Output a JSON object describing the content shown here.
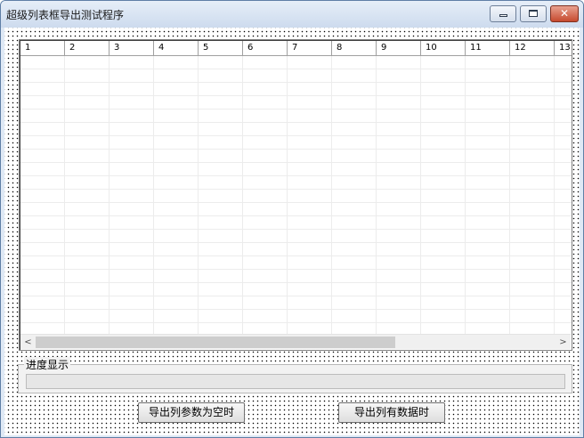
{
  "window": {
    "title": "超级列表框导出测试程序",
    "close_glyph": "✕",
    "colors": {
      "frame": "#dfe9f5",
      "close_button": "#c64a2f",
      "progress_fill": "#06b025"
    }
  },
  "grid": {
    "columns": [
      "1",
      "2",
      "3",
      "4",
      "5",
      "6",
      "7",
      "8",
      "9",
      "10",
      "11",
      "12",
      "13"
    ],
    "rows": [],
    "scroll_left_glyph": "<",
    "scroll_right_glyph": ">"
  },
  "progress_group": {
    "label": "进度显示",
    "progress_value": 0
  },
  "buttons": {
    "export_empty": "导出列参数为空时",
    "export_with_data": "导出列有数据时"
  },
  "icons": [
    "minimize-icon",
    "maximize-icon",
    "close-icon",
    "chevron-left-icon",
    "chevron-right-icon"
  ]
}
